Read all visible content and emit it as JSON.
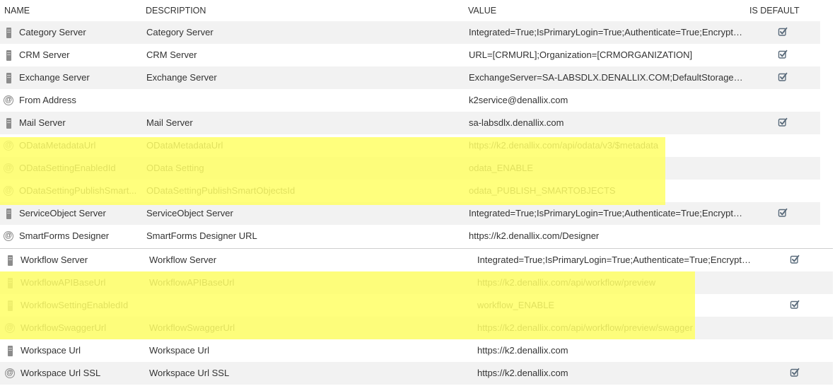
{
  "headers": {
    "name": "NAME",
    "description": "DESCRIPTION",
    "value": "VALUE",
    "is_default": "IS DEFAULT"
  },
  "icons": {
    "server": "server-icon",
    "address": "at-icon",
    "default": "checkmark-icon"
  },
  "colors": {
    "highlight": "#ffff66",
    "alt_row": "#f2f2f2",
    "icon": "#8c8c8c",
    "check": "#5a6b7b"
  },
  "rows1": [
    {
      "icon": "server",
      "name": "Category Server",
      "description": "Category Server",
      "value": "Integrated=True;IsPrimaryLogin=True;Authenticate=True;Encrypted...",
      "is_default": true
    },
    {
      "icon": "server",
      "name": "CRM Server",
      "description": "CRM Server",
      "value": "URL=[CRMURL];Organization=[CRMORGANIZATION]",
      "is_default": true
    },
    {
      "icon": "server",
      "name": "Exchange Server",
      "description": "Exchange Server",
      "value": "ExchangeServer=SA-LABSDLX.DENALLIX.COM;DefaultStorageGroup...",
      "is_default": true
    },
    {
      "icon": "address",
      "name": "From Address",
      "description": "",
      "value": "k2service@denallix.com",
      "is_default": false
    },
    {
      "icon": "server",
      "name": "Mail Server",
      "description": "Mail Server",
      "value": "sa-labsdlx.denallix.com",
      "is_default": true
    },
    {
      "icon": "address",
      "name": "ODataMetadataUrl",
      "description": "ODataMetadataUrl",
      "value": "https://k2.denallix.com/api/odata/v3/$metadata",
      "is_default": false
    },
    {
      "icon": "address",
      "name": "ODataSettingEnabledId",
      "description": "OData Setting",
      "value": "odata_ENABLE",
      "is_default": false
    },
    {
      "icon": "address",
      "name": "ODataSettingPublishSmart...",
      "description": "ODataSettingPublishSmartObjectsId",
      "value": "odata_PUBLISH_SMARTOBJECTS",
      "is_default": false
    },
    {
      "icon": "server",
      "name": "ServiceObject Server",
      "description": "ServiceObject Server",
      "value": "Integrated=True;IsPrimaryLogin=True;Authenticate=True;Encrypted...",
      "is_default": true
    },
    {
      "icon": "address",
      "name": "SmartForms Designer",
      "description": "SmartForms Designer URL",
      "value": "https://k2.denallix.com/Designer",
      "is_default": false
    }
  ],
  "rows2": [
    {
      "icon": "server",
      "name": "Workflow Server",
      "description": "Workflow Server",
      "value": "Integrated=True;IsPrimaryLogin=True;Authenticate=True;Encrypted...",
      "is_default": true
    },
    {
      "icon": "server",
      "name": "WorkflowAPIBaseUrl",
      "description": "WorkflowAPIBaseUrl",
      "value": "https://k2.denallix.com/api/workflow/preview",
      "is_default": false
    },
    {
      "icon": "server",
      "name": "WorkflowSettingEnabledId",
      "description": "",
      "value": "workflow_ENABLE",
      "is_default": true
    },
    {
      "icon": "address",
      "name": "WorkflowSwaggerUrl",
      "description": "WorkflowSwaggerUrl",
      "value": "https://k2.denallix.com/api/workflow/preview/swagger",
      "is_default": false
    },
    {
      "icon": "server",
      "name": "Workspace Url",
      "description": "Workspace Url",
      "value": "https://k2.denallix.com",
      "is_default": false
    },
    {
      "icon": "address",
      "name": "Workspace Url SSL",
      "description": "Workspace Url SSL",
      "value": "https://k2.denallix.com",
      "is_default": true
    }
  ]
}
